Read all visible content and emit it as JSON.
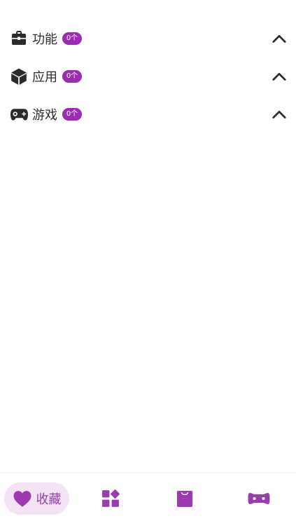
{
  "sections": [
    {
      "label": "功能",
      "count": "0个",
      "icon": "briefcase-icon"
    },
    {
      "label": "应用",
      "count": "0个",
      "icon": "cube-icon"
    },
    {
      "label": "游戏",
      "count": "0个",
      "icon": "gamepad-icon"
    }
  ],
  "bottom_nav": {
    "favorites_label": "收藏",
    "items": [
      "favorites-heart-icon",
      "apps-grid-icon",
      "store-bag-icon",
      "games-controller-icon"
    ]
  },
  "colors": {
    "accent": "#9c3bb0",
    "badge": "#9b2bb0",
    "active_pill": "#f3e3f5",
    "text": "#2e2e2e"
  }
}
